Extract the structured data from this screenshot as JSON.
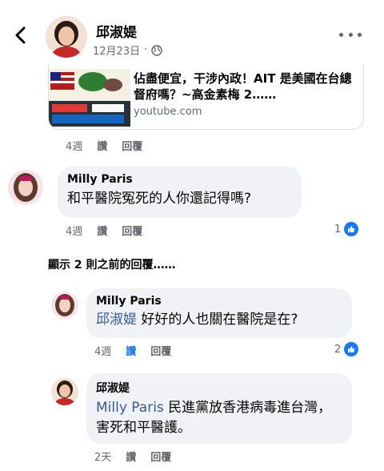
{
  "header": {
    "back_icon": "back-arrow-icon",
    "name": "邱淑媞",
    "date": "12月23日",
    "separator": "·",
    "privacy_icon": "globe-icon",
    "more_icon": "more-options-icon"
  },
  "link_preview": {
    "title": "佔盡便宜，干涉內政！AIT 是美國在台總督府嗎？~高金素梅 2……",
    "domain": "youtube.com"
  },
  "comments": [
    {
      "type": "actions",
      "time": "4週",
      "like_label": "讚",
      "reply_label": "回覆"
    },
    {
      "author": "Milly Paris",
      "text": "和平醫院冤死的人你還記得嗎?",
      "time": "4週",
      "like_label": "讚",
      "reply_label": "回覆",
      "reaction_count": "1"
    }
  ],
  "show_previous_replies": "顯示 2 則之前的回覆……",
  "replies": [
    {
      "author": "Milly Paris",
      "mention": "邱淑媞",
      "text": " 好好的人也關在醫院是在?",
      "time": "4週",
      "like_label": "讚",
      "reply_label": "回覆",
      "reaction_count": "2",
      "liked": true
    },
    {
      "author": "邱淑媞",
      "mention": "Milly Paris",
      "text": " 民進黨放香港病毒進台灣，害死和平醫護。",
      "time": "2天",
      "like_label": "讚",
      "reply_label": "回覆"
    }
  ],
  "colors": {
    "bubble": "#f0f2f5",
    "meta": "#65676b",
    "mention": "#385898",
    "like_blue": "#1877f2"
  }
}
